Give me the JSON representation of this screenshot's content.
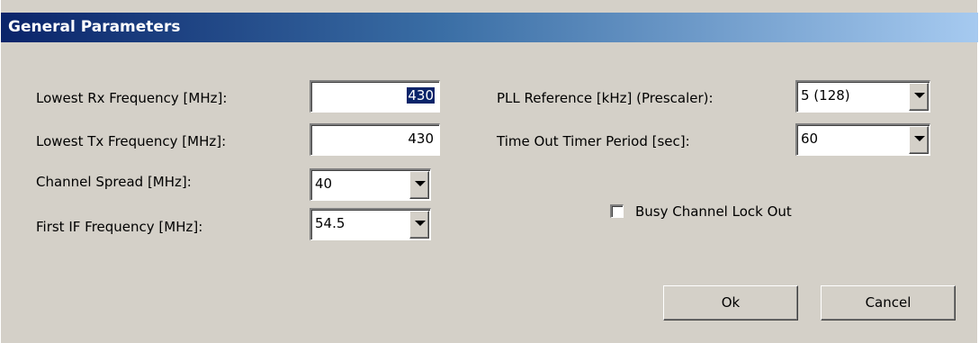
{
  "window": {
    "title": "General Parameters",
    "title_gradient": [
      "#0a246a",
      "#3a6ea5",
      "#a6caf0"
    ],
    "face_color": "#d4d0c8"
  },
  "left_fields": {
    "lowest_rx": {
      "label": "Lowest Rx Frequency [MHz]:",
      "value": "430",
      "selected": true
    },
    "lowest_tx": {
      "label": "Lowest Tx Frequency [MHz]:",
      "value": "430"
    },
    "channel_spread": {
      "label": "Channel Spread [MHz]:",
      "value": "40"
    },
    "first_if": {
      "label": "First IF Frequency [MHz]:",
      "value": "54.5"
    }
  },
  "right_fields": {
    "pll_reference": {
      "label": "PLL Reference [kHz] (Prescaler):",
      "value": "5 (128)"
    },
    "timeout_timer": {
      "label": "Time Out Timer Period [sec]:",
      "value": "60"
    },
    "busy_lockout": {
      "label": "Busy Channel Lock Out",
      "checked": false
    }
  },
  "buttons": {
    "ok": "Ok",
    "cancel": "Cancel"
  },
  "icons": {
    "dropdown": "chevron-down-icon"
  }
}
